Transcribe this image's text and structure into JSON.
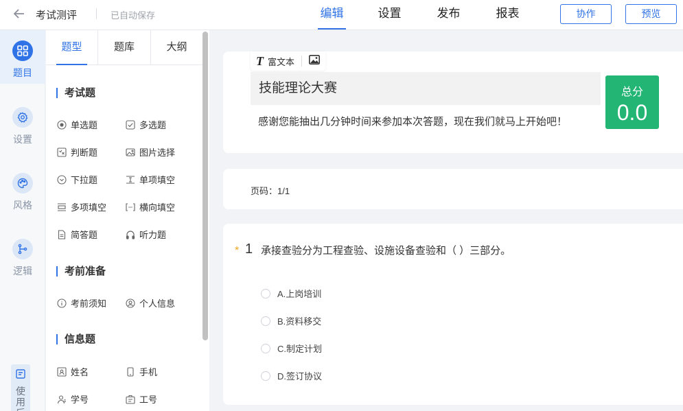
{
  "header": {
    "title": "考试测评",
    "autosave": "已自动保存",
    "nav": [
      "编辑",
      "设置",
      "发布",
      "报表"
    ],
    "collab_label": "协作",
    "preview_label": "预览"
  },
  "rail": {
    "items": [
      {
        "label": "题目",
        "icon": "grid-icon"
      },
      {
        "label": "设置",
        "icon": "gear-icon"
      },
      {
        "label": "风格",
        "icon": "palette-icon"
      },
      {
        "label": "逻辑",
        "icon": "branch-icon"
      }
    ],
    "guide": "使用后"
  },
  "panel": {
    "tabs": [
      "题型",
      "题库",
      "大纲"
    ],
    "sections": [
      {
        "title": "考试题",
        "items": [
          {
            "label": "单选题",
            "icon": "radio-icon"
          },
          {
            "label": "多选题",
            "icon": "checkbox-icon"
          },
          {
            "label": "判断题",
            "icon": "judge-icon"
          },
          {
            "label": "图片选择",
            "icon": "image-icon"
          },
          {
            "label": "下拉题",
            "icon": "dropdown-icon"
          },
          {
            "label": "单项填空",
            "icon": "fill-icon"
          },
          {
            "label": "多项填空",
            "icon": "multi-fill-icon"
          },
          {
            "label": "横向填空",
            "icon": "horizontal-fill-icon"
          },
          {
            "label": "简答题",
            "icon": "document-icon"
          },
          {
            "label": "听力题",
            "icon": "headphone-icon"
          }
        ]
      },
      {
        "title": "考前准备",
        "items": [
          {
            "label": "考前须知",
            "icon": "info-icon"
          },
          {
            "label": "个人信息",
            "icon": "user-circle-icon"
          }
        ]
      },
      {
        "title": "信息题",
        "items": [
          {
            "label": "姓名",
            "icon": "id-card-icon"
          },
          {
            "label": "手机",
            "icon": "phone-icon"
          },
          {
            "label": "学号",
            "icon": "student-icon"
          },
          {
            "label": "工号",
            "icon": "badge-icon"
          }
        ]
      }
    ]
  },
  "editor": {
    "toolbar": {
      "rich_text": "富文本",
      "bold_glyph": "T"
    },
    "exam_title": "技能理论大赛",
    "welcome": "感谢您能抽出几分钟时间来参加本次答题，现在我们就马上开始吧！",
    "score_label": "总分",
    "score_value": "0.0",
    "page_indicator": "页码：1/1",
    "question": {
      "required_mark": "*",
      "number": "1",
      "text": "承接查验分为工程查验、设施设备查验和（ ）三部分。",
      "options": [
        "A.上岗培训",
        "B.资料移交",
        "C.制定计划",
        "D.签订协议"
      ]
    }
  },
  "colors": {
    "accent": "#2f73e6",
    "score_bg": "#22b573",
    "required": "#f5a623"
  }
}
